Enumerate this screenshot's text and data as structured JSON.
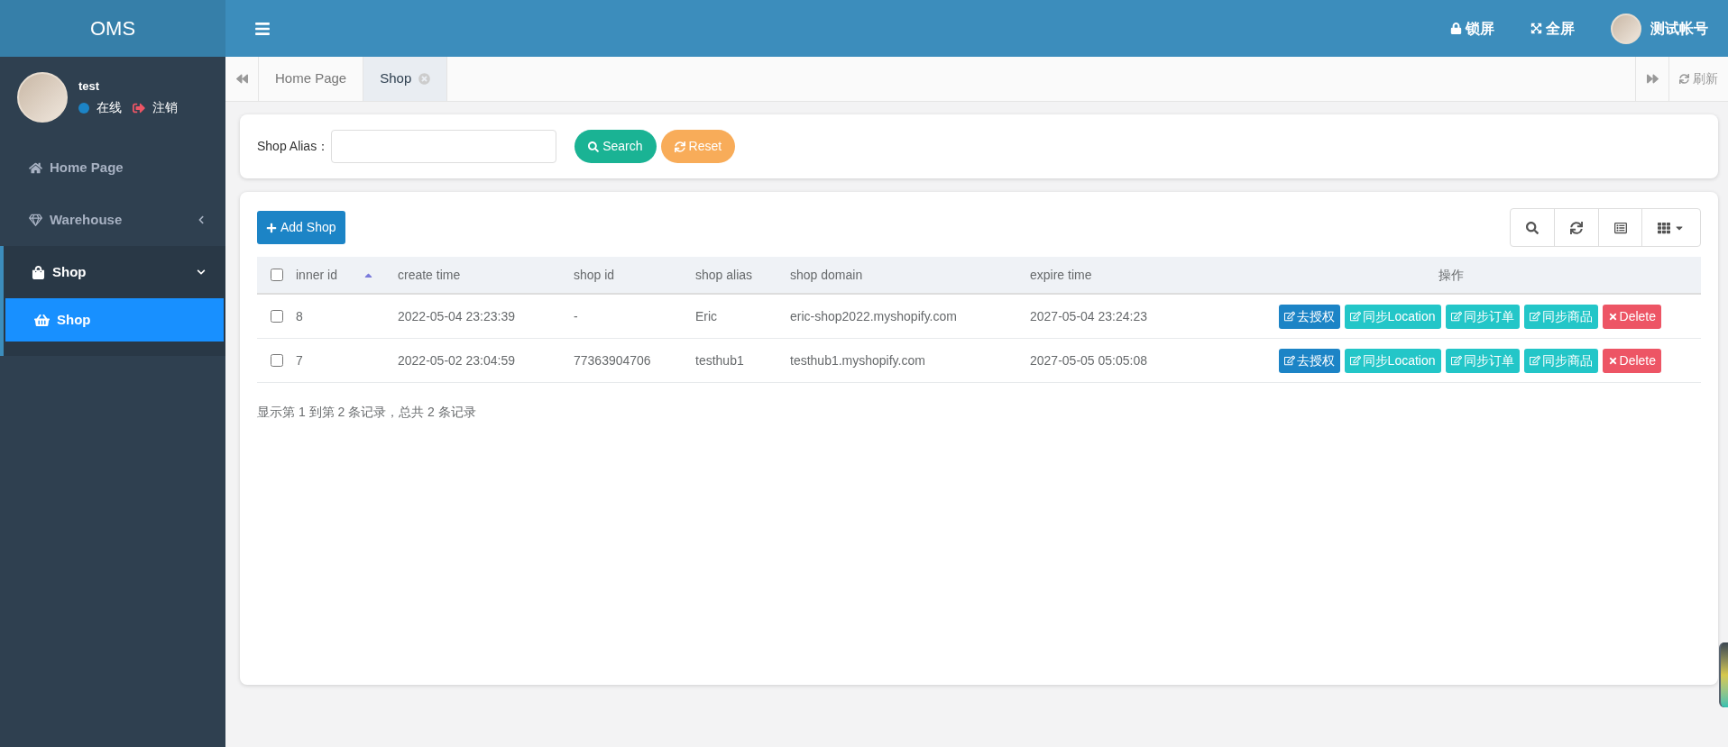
{
  "header": {
    "logo": "OMS",
    "actions": [
      {
        "kind": "lock",
        "label": "锁屏"
      },
      {
        "kind": "fullscreen",
        "label": "全屏"
      }
    ],
    "user": "测试帐号"
  },
  "sidebar": {
    "user": {
      "name": "test",
      "status": "在线",
      "logout": "注销",
      "online": true
    },
    "items": [
      {
        "label": "Home Page",
        "expanded": false
      },
      {
        "label": "Warehouse",
        "expanded": false
      },
      {
        "label": "Shop",
        "expanded": true,
        "children": [
          {
            "label": "Shop",
            "selected": true
          }
        ]
      }
    ]
  },
  "tabs": [
    {
      "label": "Home Page",
      "selected": false,
      "closable": false
    },
    {
      "label": "Shop",
      "selected": true,
      "closable": true
    }
  ],
  "refresh": "刷新",
  "search": {
    "label": "Shop Alias：",
    "buttons": [
      {
        "kind": "search",
        "label": "Search"
      },
      {
        "kind": "reset",
        "label": "Reset"
      }
    ]
  },
  "add_button": "Add Shop",
  "table": {
    "columns": [
      {
        "label": "inner id",
        "sorted": true
      },
      {
        "label": "create time",
        "sorted": false
      },
      {
        "label": "shop id",
        "sorted": false
      },
      {
        "label": "shop alias",
        "sorted": false
      },
      {
        "label": "shop domain",
        "sorted": false
      },
      {
        "label": "expire time",
        "sorted": false
      },
      {
        "label": "操作",
        "sorted": false
      }
    ],
    "rows": [
      {
        "checked": false,
        "cells": [
          "8",
          "2022-05-04 23:23:39",
          "-",
          "Eric",
          "eric-shop2022.myshopify.com",
          "2027-05-04 23:24:23"
        ],
        "actions": [
          {
            "kind": "primary",
            "label": "去授权"
          },
          {
            "kind": "info",
            "label": "同步Location"
          },
          {
            "kind": "info",
            "label": "同步订单"
          },
          {
            "kind": "info",
            "label": "同步商品"
          },
          {
            "kind": "danger",
            "label": "Delete"
          }
        ]
      },
      {
        "checked": false,
        "cells": [
          "7",
          "2022-05-02 23:04:59",
          "77363904706",
          "testhub1",
          "testhub1.myshopify.com",
          "2027-05-05 05:05:08"
        ],
        "actions": [
          {
            "kind": "primary",
            "label": "去授权"
          },
          {
            "kind": "info",
            "label": "同步Location"
          },
          {
            "kind": "info",
            "label": "同步订单"
          },
          {
            "kind": "info",
            "label": "同步商品"
          },
          {
            "kind": "danger",
            "label": "Delete"
          }
        ]
      }
    ],
    "all_checked": false,
    "footer": "显示第 1 到第 2 条记录，总共 2 条记录"
  }
}
